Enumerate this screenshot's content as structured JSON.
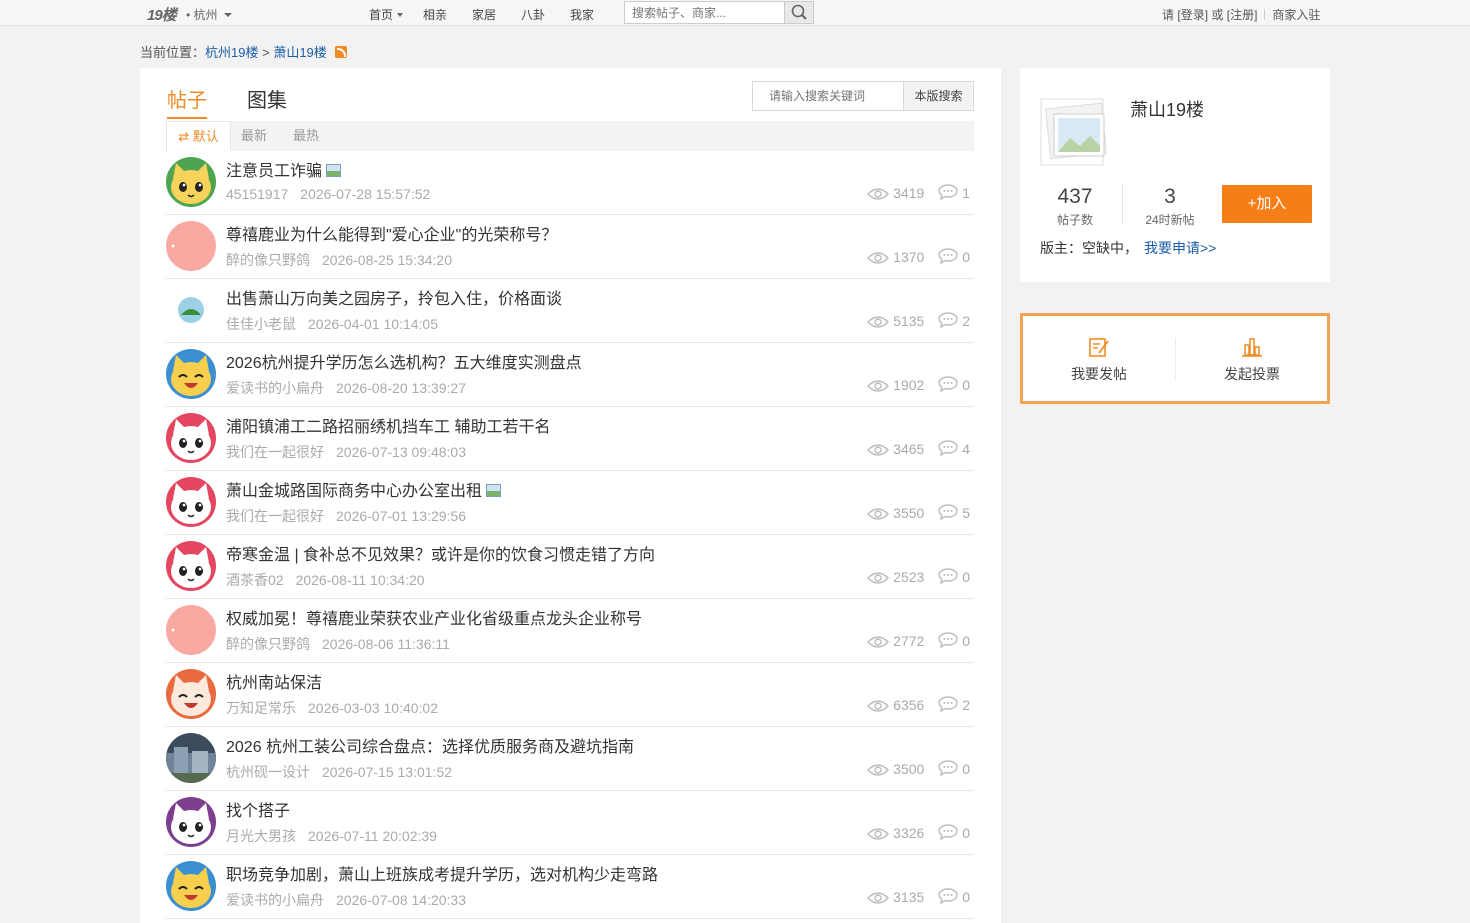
{
  "topbar": {
    "logo": "19楼",
    "city": "• 杭州",
    "nav": [
      "首页",
      "相亲",
      "家居",
      "八卦",
      "我家"
    ],
    "search_placeholder": "搜索帖子、商家...",
    "login_prefix": "请",
    "login": "[登录]",
    "or": "或",
    "register": "[注册]",
    "merchant": "商家入驻"
  },
  "breadcrumb": {
    "label": "当前位置：",
    "level1": "杭州19楼",
    "sep": ">",
    "level2": "萧山19楼"
  },
  "main": {
    "tabs": [
      "帖子",
      "图集"
    ],
    "board_search_placeholder": "请输入搜索关键词",
    "board_search_button": "本版搜索",
    "sorts": [
      "⇄ 默认",
      "最新",
      "最热"
    ],
    "posts": [
      {
        "title": "注意员工诈骗",
        "has_image": true,
        "author": "45151917",
        "time": "2026-07-28 15:57:52",
        "views": "3419",
        "replies": "1",
        "avatar": "yellow-cat"
      },
      {
        "title": "尊禧鹿业为什么能得到\"爱心企业\"的光荣称号？",
        "has_image": false,
        "author": "醉的像只野鸽",
        "time": "2026-08-25 15:34:20",
        "views": "1370",
        "replies": "0",
        "avatar": "pink-blank"
      },
      {
        "title": "出售萧山万向美之园房子，拎包入住，价格面谈",
        "has_image": false,
        "author": "佳佳小老鼠",
        "time": "2026-04-01 10:14:05",
        "views": "5135",
        "replies": "2",
        "avatar": "green-badge"
      },
      {
        "title": "2026杭州提升学历怎么选机构？五大维度实测盘点",
        "has_image": false,
        "author": "爱读书的小扁舟",
        "time": "2026-08-20 13:39:27",
        "views": "1902",
        "replies": "0",
        "avatar": "yellow-happy"
      },
      {
        "title": "浦阳镇浦工二路招丽绣机挡车工 辅助工若干名",
        "has_image": false,
        "author": "我们在一起很好",
        "time": "2026-07-13 09:48:03",
        "views": "3465",
        "replies": "4",
        "avatar": "pink-cat"
      },
      {
        "title": "萧山金城路国际商务中心办公室出租",
        "has_image": true,
        "author": "我们在一起很好",
        "time": "2026-07-01 13:29:56",
        "views": "3550",
        "replies": "5",
        "avatar": "pink-cat"
      },
      {
        "title": "帝寒金温 | 食补总不见效果？或许是你的饮食习惯走错了方向",
        "has_image": false,
        "author": "酒茶香02",
        "time": "2026-08-11 10:34:20",
        "views": "2523",
        "replies": "0",
        "avatar": "pink-cat"
      },
      {
        "title": "权威加冕！尊禧鹿业荣获农业产业化省级重点龙头企业称号",
        "has_image": false,
        "author": "醉的像只野鸽",
        "time": "2026-08-06 11:36:11",
        "views": "2772",
        "replies": "0",
        "avatar": "pink-blank"
      },
      {
        "title": "杭州南站保洁",
        "has_image": false,
        "author": "万知足常乐",
        "time": "2026-03-03 10:40:02",
        "views": "6356",
        "replies": "2",
        "avatar": "orange-happy"
      },
      {
        "title": "2026 杭州工装公司综合盘点：选择优质服务商及避坑指南",
        "has_image": false,
        "author": "杭州砚一设计",
        "time": "2026-07-15 13:01:52",
        "views": "3500",
        "replies": "0",
        "avatar": "photo"
      },
      {
        "title": "找个搭子",
        "has_image": false,
        "author": "月光大男孩",
        "time": "2026-07-11 20:02:39",
        "views": "3326",
        "replies": "0",
        "avatar": "purple-cat"
      },
      {
        "title": "职场竞争加剧，萧山上班族成考提升学历，选对机构少走弯路",
        "has_image": false,
        "author": "爱读书的小扁舟",
        "time": "2026-07-08 14:20:33",
        "views": "3135",
        "replies": "0",
        "avatar": "yellow-happy"
      }
    ]
  },
  "side": {
    "title": "萧山19楼",
    "post_count": "437",
    "post_count_label": "帖子数",
    "new_24h": "3",
    "new_24h_label": "24时新帖",
    "join_button": "+加入",
    "moderator_label": "版主：空缺中，",
    "apply_link": "我要申请>>",
    "actions": [
      "我要发帖",
      "发起投票"
    ]
  },
  "colors": {
    "accent": "#f08a24",
    "join": "#f57e16",
    "link": "#1b5ea6",
    "action_border": "#f5a353"
  }
}
